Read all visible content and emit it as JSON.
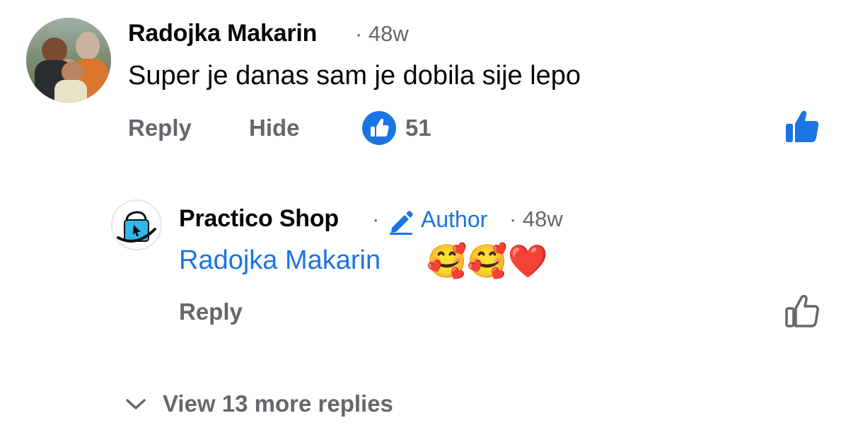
{
  "comment": {
    "author": "Radojka Makarin",
    "time": "· 48w",
    "text": "Super je danas sam je dobila sije lepo",
    "actions": {
      "reply": "Reply",
      "hide": "Hide"
    },
    "reaction_count": "51",
    "colors": {
      "primary": "#1b74e4",
      "secondary_text": "#65676b"
    }
  },
  "reply": {
    "author": "Practico Shop",
    "dot": "·",
    "badge_label": "Author",
    "time": "· 48w",
    "mention": "Radojka Makarin",
    "emojis": "🥰🥰❤️",
    "actions": {
      "reply": "Reply"
    }
  },
  "footer": {
    "more_replies": "View 13 more replies"
  },
  "icons": {
    "reaction": "like-reaction-icon",
    "like_filled": "thumbs-up-filled-icon",
    "like_outline": "thumbs-up-outline-icon",
    "author_badge": "pencil-icon",
    "expand": "chevron-down-icon"
  }
}
